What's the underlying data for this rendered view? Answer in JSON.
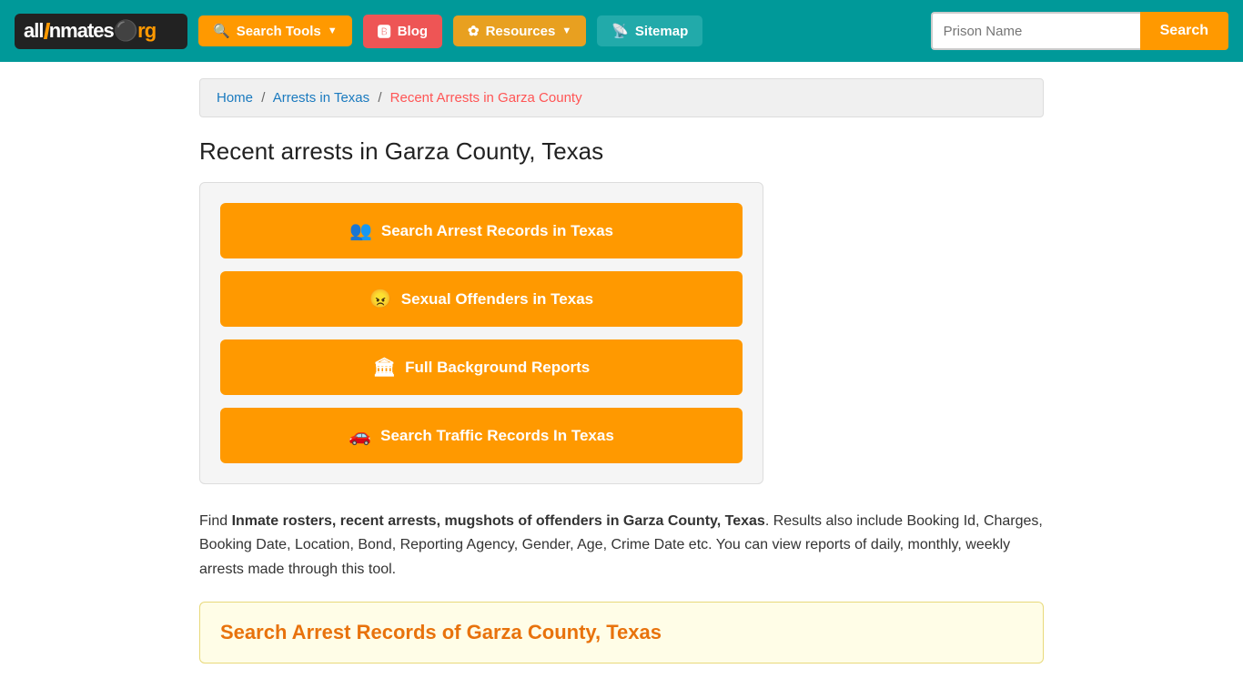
{
  "site": {
    "logo_all": "all",
    "logo_inmates": "Inmates",
    "logo_org": ".org"
  },
  "header": {
    "nav": [
      {
        "id": "search-tools",
        "label": "Search Tools",
        "type": "dropdown",
        "class": "search-tools-btn"
      },
      {
        "id": "blog",
        "label": "Blog",
        "type": "link",
        "class": "blog-btn"
      },
      {
        "id": "resources",
        "label": "Resources",
        "type": "dropdown",
        "class": "resources-btn"
      },
      {
        "id": "sitemap",
        "label": "Sitemap",
        "type": "link",
        "class": "sitemap-btn"
      }
    ],
    "search_placeholder": "Prison Name",
    "search_button_label": "Search"
  },
  "breadcrumb": {
    "home": "Home",
    "arrests_in_texas": "Arrests in Texas",
    "current": "Recent Arrests in Garza County"
  },
  "page": {
    "title": "Recent arrests in Garza County, Texas",
    "buttons": [
      {
        "id": "arrest-records",
        "icon": "👥",
        "label": "Search Arrest Records in Texas"
      },
      {
        "id": "sexual-offenders",
        "icon": "😠",
        "label": "Sexual Offenders in Texas"
      },
      {
        "id": "background-reports",
        "icon": "🏛",
        "label": "Full Background Reports"
      },
      {
        "id": "traffic-records",
        "icon": "🚗",
        "label": "Search Traffic Records In Texas"
      }
    ],
    "description_intro": "Find ",
    "description_bold": "Inmate rosters, recent arrests, mugshots of offenders in Garza County, Texas",
    "description_rest": ". Results also include Booking Id, Charges, Booking Date, Location, Bond, Reporting Agency, Gender, Age, Crime Date etc. You can view reports of daily, monthly, weekly arrests made through this tool.",
    "search_section_title": "Search Arrest Records of Garza County, Texas"
  }
}
